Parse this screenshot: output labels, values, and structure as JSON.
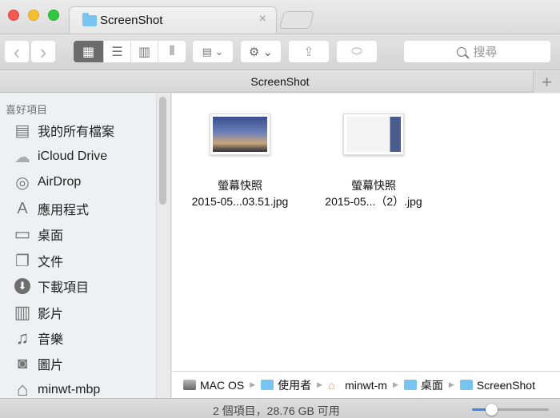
{
  "window": {
    "tab_title": "ScreenShot",
    "tab_close": "×",
    "path_title": "ScreenShot",
    "new_tab_plus": "+"
  },
  "toolbar": {
    "back": "‹",
    "forward": "›",
    "view_modes": [
      {
        "name": "icon-view",
        "icon": "grid-icon",
        "glyph": "▦",
        "active": true
      },
      {
        "name": "list-view",
        "icon": "list-icon",
        "glyph": "☰",
        "active": false
      },
      {
        "name": "column-view",
        "icon": "columns-icon",
        "glyph": "▥",
        "active": false
      },
      {
        "name": "cover-flow-view",
        "icon": "cover-flow-icon",
        "glyph": "⫴",
        "active": false
      }
    ],
    "arrange_glyph": "▤ ⌄",
    "action_glyph": "⚙ ⌄",
    "share_glyph": "⇪",
    "tag_glyph": "⬭",
    "search_placeholder": "搜尋"
  },
  "sidebar": {
    "header": "喜好項目",
    "items": [
      {
        "label": "我的所有檔案",
        "icon": "all-my-files-icon",
        "glyph": "▤"
      },
      {
        "label": "iCloud Drive",
        "icon": "cloud-icon",
        "glyph": "☁"
      },
      {
        "label": "AirDrop",
        "icon": "airdrop-icon",
        "glyph": "◎"
      },
      {
        "label": "應用程式",
        "icon": "applications-icon",
        "glyph": "A"
      },
      {
        "label": "桌面",
        "icon": "desktop-icon",
        "glyph": "▭"
      },
      {
        "label": "文件",
        "icon": "documents-icon",
        "glyph": "❐"
      },
      {
        "label": "下載項目",
        "icon": "downloads-icon",
        "glyph": "⬇"
      },
      {
        "label": "影片",
        "icon": "movies-icon",
        "glyph": "▥"
      },
      {
        "label": "音樂",
        "icon": "music-icon",
        "glyph": "♫"
      },
      {
        "label": "圖片",
        "icon": "pictures-icon",
        "glyph": "◙"
      },
      {
        "label": "minwt-mbp",
        "icon": "home-icon",
        "glyph": "⌂"
      }
    ]
  },
  "files": [
    {
      "line1": "螢幕快照",
      "line2": "2015-05...03.51.jpg"
    },
    {
      "line1": "螢幕快照",
      "line2": "2015-05...（2）.jpg"
    }
  ],
  "pathbar": {
    "crumbs": [
      "MAC OS",
      "使用者",
      "minwt-m",
      "桌面",
      "ScreenShot"
    ],
    "separator": "▶"
  },
  "status": {
    "text": "2 個項目，28.76 GB 可用",
    "icon_size_slider": 0.25
  }
}
